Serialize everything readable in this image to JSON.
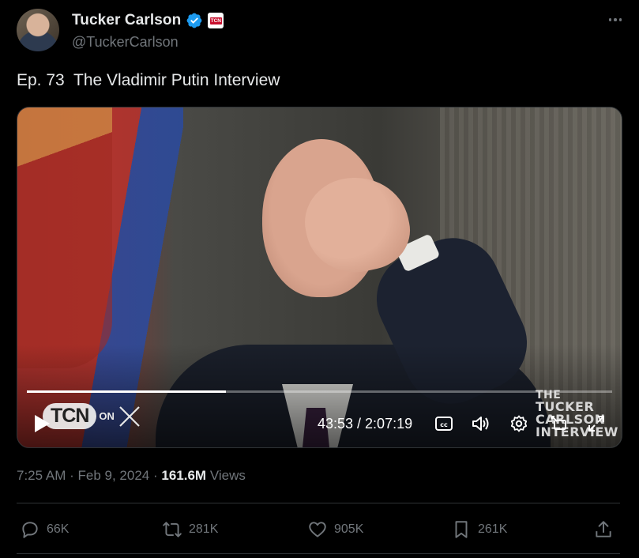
{
  "author": {
    "name": "Tucker Carlson",
    "handle": "@TuckerCarlson",
    "affiliate_badge": "TCN"
  },
  "tweet": {
    "text": "Ep. 73  The Vladimir Putin Interview"
  },
  "video": {
    "current_time": "43:53",
    "duration": "2:07:19",
    "time_display": "43:53 / 2:07:19",
    "progress_fraction": 0.34,
    "overlay_logo": "TCN",
    "overlay_on": "ON",
    "overlay_x": "X",
    "show_logo_lines": [
      "THE",
      "TUCKER",
      "CARLSON",
      "INTERVIEW"
    ]
  },
  "meta": {
    "time": "7:25 AM",
    "date": "Feb 9, 2024",
    "views_count": "161.6M",
    "views_label": "Views"
  },
  "actions": {
    "replies": "66K",
    "reposts": "281K",
    "likes": "905K",
    "bookmarks": "261K"
  },
  "colors": {
    "background": "#000000",
    "text_primary": "#e7e9ea",
    "text_secondary": "#71767b",
    "verified": "#1d9bf0",
    "divider": "#2f3336"
  }
}
